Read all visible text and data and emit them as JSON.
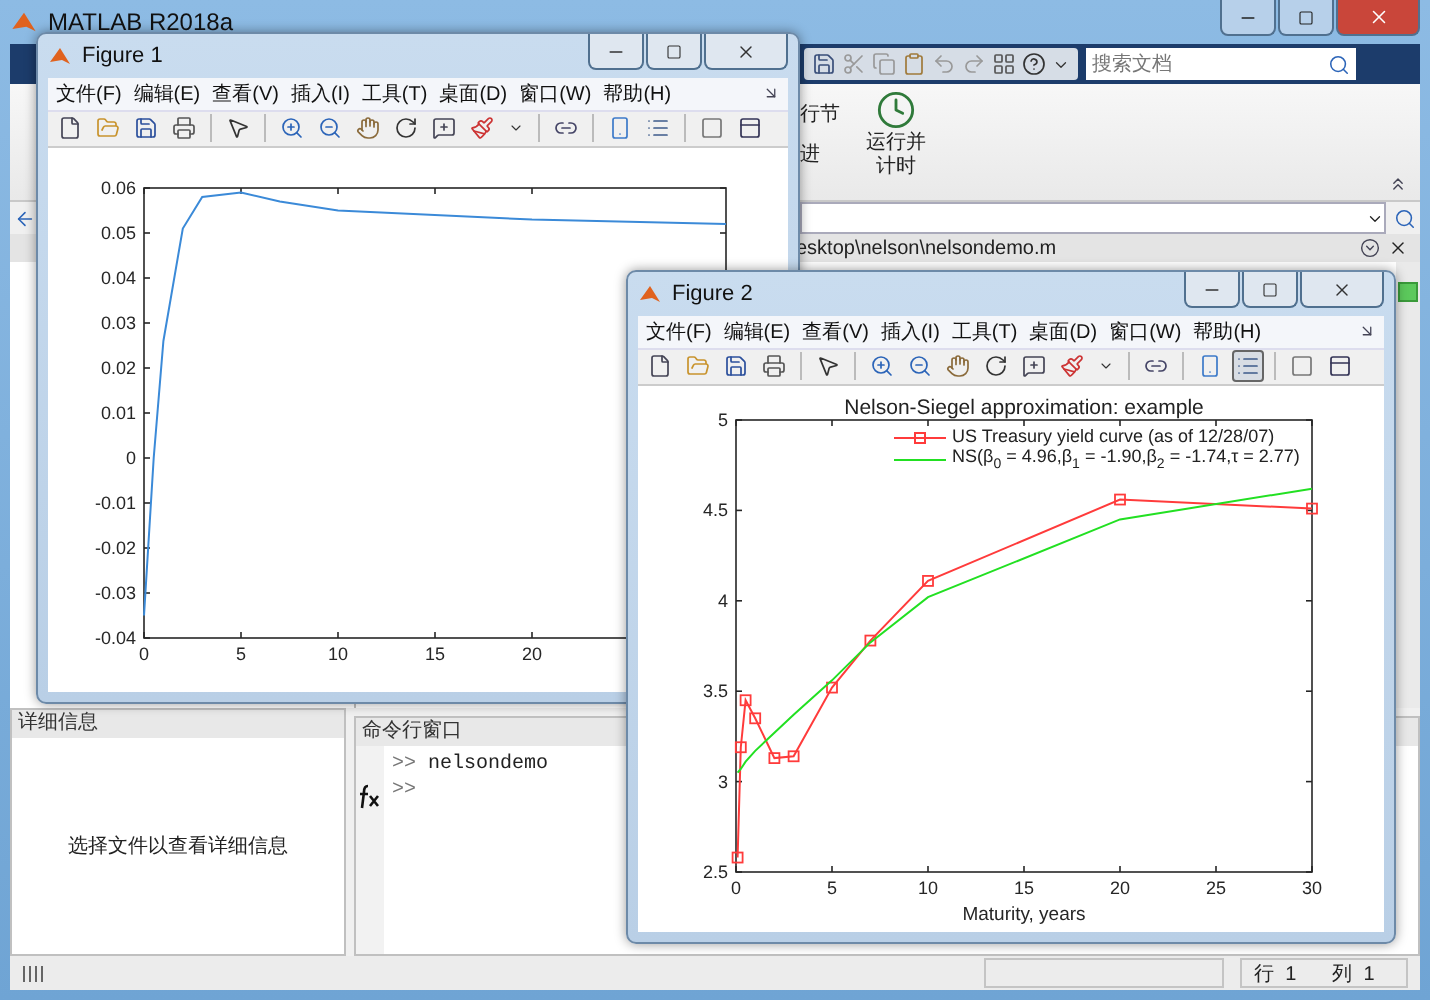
{
  "main_window": {
    "title": "MATLAB R2018a",
    "search": {
      "placeholder": "搜索文档"
    },
    "ribbon": {
      "run_section_label": "行节",
      "advance_label": "进",
      "run_and_time_label": "运行并计时"
    },
    "file_path": "esktop\\nelson\\nelsondemo.m",
    "details_panel": {
      "title": "详细信息",
      "message": "选择文件以查看详细信息"
    },
    "command_window": {
      "title": "命令行窗口",
      "lines": [
        {
          "prompt": ">>",
          "text": "nelsondemo"
        },
        {
          "prompt": ">>"
        }
      ]
    },
    "status_bar": [
      {
        "label": "行",
        "value": "1"
      },
      {
        "label": "列",
        "value": "1"
      }
    ]
  },
  "figures": [
    {
      "title": "Figure 1",
      "menu": [
        "文件(F)",
        "编辑(E)",
        "查看(V)",
        "插入(I)",
        "工具(T)",
        "桌面(D)",
        "窗口(W)",
        "帮助(H)"
      ],
      "legend_button_selected": false,
      "chart_data": {
        "type": "line",
        "x": [
          0,
          0.5,
          1,
          2,
          3,
          5,
          7,
          10,
          20,
          30
        ],
        "series": [
          {
            "color": "#3b8ad8",
            "values": [
              -0.035,
              0,
              0.026,
              0.051,
              0.058,
              0.059,
              0.057,
              0.055,
              0.053,
              0.052
            ]
          }
        ],
        "xlim": [
          0,
          30
        ],
        "ylim": [
          -0.04,
          0.06
        ],
        "xticks": [
          0,
          5,
          10,
          15,
          20
        ],
        "yticks": [
          -0.04,
          -0.03,
          -0.02,
          -0.01,
          0,
          0.01,
          0.02,
          0.03,
          0.04,
          0.05,
          0.06
        ]
      }
    },
    {
      "title": "Figure 2",
      "menu": [
        "文件(F)",
        "编辑(E)",
        "查看(V)",
        "插入(I)",
        "工具(T)",
        "桌面(D)",
        "窗口(W)",
        "帮助(H)"
      ],
      "legend_button_selected": true,
      "chart_data": {
        "type": "line",
        "title": "Nelson-Siegel approximation: example",
        "xlabel": "Maturity, years",
        "x": [
          0.083,
          0.25,
          0.5,
          1,
          2,
          3,
          5,
          7,
          10,
          20,
          30
        ],
        "series": [
          {
            "name": "US Treasury yield curve (as of 12/28/07)",
            "color": "#ff3b3b",
            "marker": "square",
            "values": [
              2.58,
              3.19,
              3.45,
              3.35,
              3.13,
              3.14,
              3.52,
              3.78,
              4.11,
              4.56,
              4.51
            ]
          },
          {
            "name": "NS(β$_{0}$ = 4.96,β$_{1}$ = -1.90,β$_{2}$ = -1.74,τ = 2.77)",
            "color": "#22e022",
            "values": [
              3.05,
              3.07,
              3.11,
              3.17,
              3.27,
              3.37,
              3.56,
              3.77,
              4.02,
              4.45,
              4.62
            ]
          }
        ],
        "xlim": [
          0,
          30
        ],
        "ylim": [
          2.5,
          5
        ],
        "xticks": [
          0,
          5,
          10,
          15,
          20,
          25,
          30
        ],
        "yticks": [
          2.5,
          3,
          3.5,
          4,
          4.5,
          5
        ]
      }
    }
  ]
}
